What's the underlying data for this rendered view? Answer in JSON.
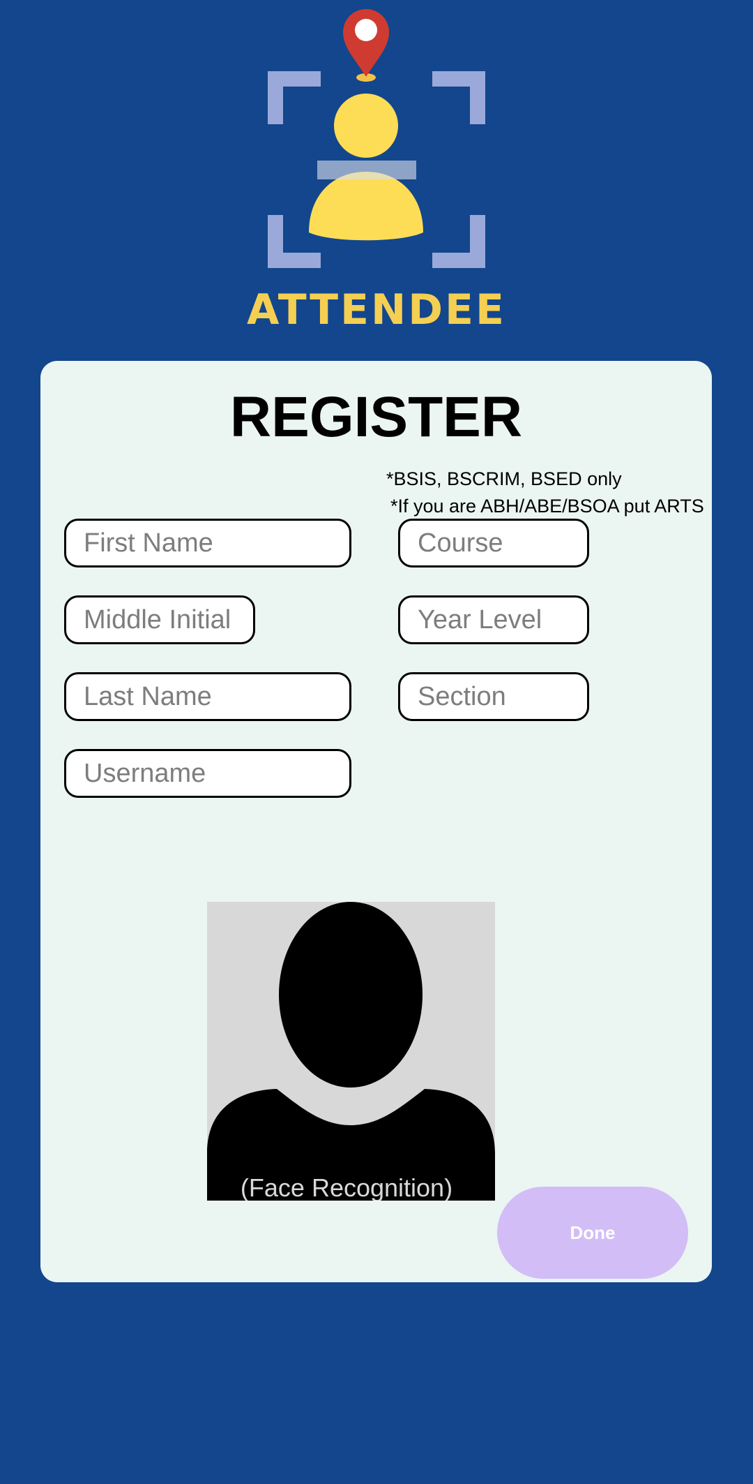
{
  "brand": {
    "name": "ATTENDEE",
    "logo_icon": "person-location-scan-icon",
    "colors": {
      "background": "#13468c",
      "brand_text": "#f5cf52",
      "pin": "#cf3b30",
      "person": "#fedd56",
      "frame": "#9aa9d9"
    }
  },
  "register": {
    "title": "REGISTER",
    "notes": [
      "*BSIS, BSCRIM, BSED only",
      "*If you are ABH/ABE/BSOA put ARTS"
    ],
    "fields": {
      "first_name": {
        "placeholder": "First Name",
        "value": ""
      },
      "middle_initial": {
        "placeholder": "Middle Initial",
        "value": ""
      },
      "last_name": {
        "placeholder": "Last Name",
        "value": ""
      },
      "username": {
        "placeholder": "Username",
        "value": ""
      },
      "course": {
        "placeholder": "Course",
        "value": ""
      },
      "year_level": {
        "placeholder": "Year Level",
        "value": ""
      },
      "section": {
        "placeholder": "Section",
        "value": ""
      }
    },
    "face": {
      "icon": "person-silhouette-icon",
      "label": "(Face Recognition)"
    },
    "done_label": "Done"
  }
}
